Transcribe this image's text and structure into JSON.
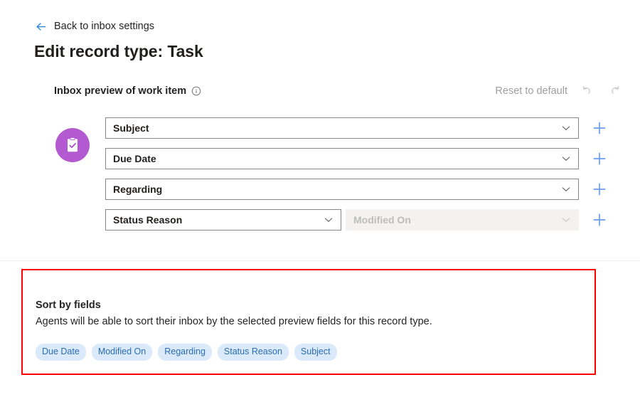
{
  "colors": {
    "accent_blue": "#2b88d8",
    "link_blue": "#0078d4",
    "plus_blue": "#6a9ff0",
    "record_purple": "#b45ad0",
    "highlight_red": "#ff0000",
    "chip_bg": "#daeafb",
    "chip_text": "#2b6cb0",
    "disabled_bg": "#f3f2f1",
    "disabled_text": "#bdbdbd"
  },
  "back_link": {
    "icon": "arrow-left-icon",
    "label": "Back to inbox settings"
  },
  "page_title": "Edit record type: Task",
  "preview_section": {
    "title": "Inbox preview of work item",
    "info_icon": "info-icon",
    "reset_label": "Reset to default",
    "undo_icon": "undo-icon",
    "redo_icon": "redo-icon",
    "record_icon": "task-clipboard-icon",
    "add_icon": "plus-icon",
    "chevron_icon": "chevron-down-icon",
    "rows": [
      {
        "fields": [
          {
            "value": "Subject",
            "disabled": false,
            "width": "full"
          }
        ],
        "add_label": "+"
      },
      {
        "fields": [
          {
            "value": "Due Date",
            "disabled": false,
            "width": "full"
          }
        ],
        "add_label": "+"
      },
      {
        "fields": [
          {
            "value": "Regarding",
            "disabled": false,
            "width": "full"
          }
        ],
        "add_label": "+"
      },
      {
        "fields": [
          {
            "value": "Status Reason",
            "disabled": false,
            "width": "half"
          },
          {
            "value": "Modified On",
            "disabled": true,
            "width": "half"
          }
        ],
        "add_label": "+"
      }
    ]
  },
  "sort_section": {
    "title": "Sort by fields",
    "description": "Agents will be able to sort their inbox by the selected preview fields for this record type.",
    "chips": [
      "Due Date",
      "Modified On",
      "Regarding",
      "Status Reason",
      "Subject"
    ]
  }
}
